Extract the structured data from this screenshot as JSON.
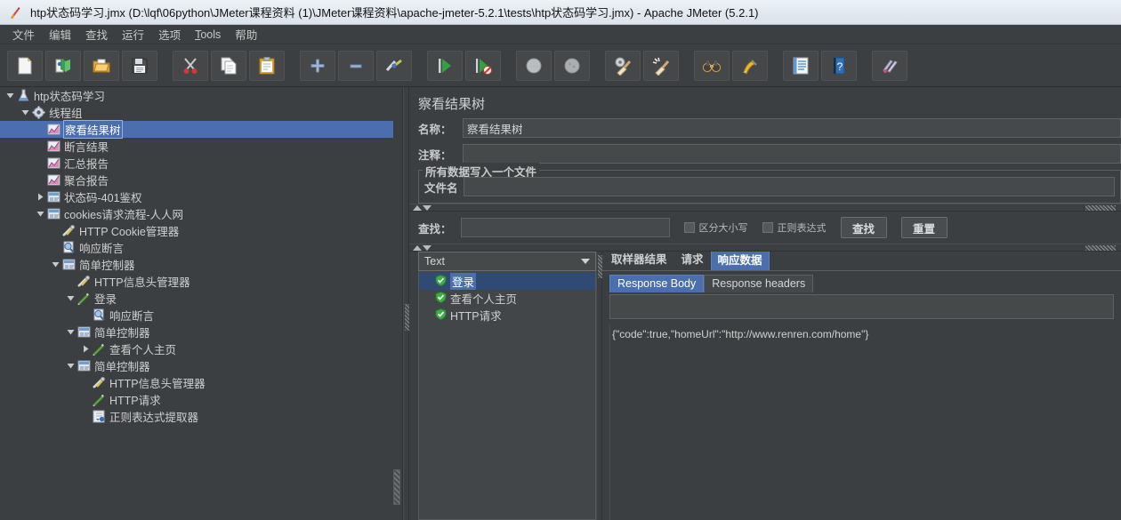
{
  "window": {
    "title": "htp状态码学习.jmx (D:\\lqf\\06python\\JMeter课程资料 (1)\\JMeter课程资料\\apache-jmeter-5.2.1\\tests\\htp状态码学习.jmx) - Apache JMeter (5.2.1)",
    "app_icon": "jmeter-feather-icon"
  },
  "menubar": {
    "items": [
      {
        "label": "文件"
      },
      {
        "label": "编辑"
      },
      {
        "label": "查找"
      },
      {
        "label": "运行"
      },
      {
        "label": "选项"
      },
      {
        "label": "Tools",
        "mnemonic": "T"
      },
      {
        "label": "帮助"
      }
    ]
  },
  "toolbar": {
    "buttons": [
      {
        "name": "new-test-plan",
        "icon": "new-document-icon"
      },
      {
        "name": "templates",
        "icon": "templates-icon"
      },
      {
        "name": "open",
        "icon": "open-folder-icon"
      },
      {
        "name": "save",
        "icon": "save-floppy-icon"
      },
      {
        "name": "cut",
        "icon": "scissors-icon"
      },
      {
        "name": "copy",
        "icon": "copy-pages-icon"
      },
      {
        "name": "paste",
        "icon": "clipboard-icon"
      },
      {
        "name": "expand-all",
        "icon": "plus-icon"
      },
      {
        "name": "collapse-all",
        "icon": "minus-icon"
      },
      {
        "name": "toggle",
        "icon": "toggle-pencil-icon"
      },
      {
        "name": "start",
        "icon": "green-play-icon"
      },
      {
        "name": "start-no-pauses",
        "icon": "green-play-nopause-icon"
      },
      {
        "name": "stop",
        "icon": "stop-circle-icon"
      },
      {
        "name": "shutdown",
        "icon": "shutdown-circle-icon"
      },
      {
        "name": "clear",
        "icon": "clear-broom-gear-icon"
      },
      {
        "name": "clear-all",
        "icon": "clear-all-broom-icon"
      },
      {
        "name": "search",
        "icon": "binoculars-icon"
      },
      {
        "name": "reset-search",
        "icon": "reset-brush-icon"
      },
      {
        "name": "function-helper",
        "icon": "function-list-icon"
      },
      {
        "name": "help",
        "icon": "help-question-icon"
      },
      {
        "name": "undo-redo",
        "icon": "feather-cluster-icon"
      }
    ]
  },
  "tree": {
    "items": [
      {
        "label": "htp状态码学习",
        "depth": 0,
        "twisty": "down",
        "icon": "test-plan-icon",
        "selected": false
      },
      {
        "label": "线程组",
        "depth": 1,
        "twisty": "down",
        "icon": "thread-group-gear-icon",
        "selected": false
      },
      {
        "label": "察看结果树",
        "depth": 2,
        "twisty": "none",
        "icon": "listener-chart-icon",
        "selected": true
      },
      {
        "label": "断言结果",
        "depth": 2,
        "twisty": "none",
        "icon": "listener-chart-icon",
        "selected": false
      },
      {
        "label": "汇总报告",
        "depth": 2,
        "twisty": "none",
        "icon": "listener-chart-icon",
        "selected": false
      },
      {
        "label": "聚合报告",
        "depth": 2,
        "twisty": "none",
        "icon": "listener-chart-icon",
        "selected": false
      },
      {
        "label": "状态码-401鉴权",
        "depth": 2,
        "twisty": "right",
        "icon": "controller-icon",
        "selected": false
      },
      {
        "label": "cookies请求流程-人人网",
        "depth": 2,
        "twisty": "down",
        "icon": "controller-icon",
        "selected": false
      },
      {
        "label": "HTTP Cookie管理器",
        "depth": 3,
        "twisty": "none",
        "icon": "config-wrench-icon",
        "selected": false
      },
      {
        "label": "响应断言",
        "depth": 3,
        "twisty": "none",
        "icon": "assertion-magnifier-icon",
        "selected": false
      },
      {
        "label": "简单控制器",
        "depth": 3,
        "twisty": "down",
        "icon": "controller-icon",
        "selected": false
      },
      {
        "label": "HTTP信息头管理器",
        "depth": 4,
        "twisty": "none",
        "icon": "config-wrench-icon",
        "selected": false
      },
      {
        "label": "登录",
        "depth": 4,
        "twisty": "down",
        "icon": "sampler-pencil-icon",
        "selected": false
      },
      {
        "label": "响应断言",
        "depth": 5,
        "twisty": "none",
        "icon": "assertion-magnifier-icon",
        "selected": false
      },
      {
        "label": "简单控制器",
        "depth": 4,
        "twisty": "down",
        "icon": "controller-icon",
        "selected": false
      },
      {
        "label": "查看个人主页",
        "depth": 5,
        "twisty": "right",
        "icon": "sampler-pencil-icon",
        "selected": false
      },
      {
        "label": "简单控制器",
        "depth": 4,
        "twisty": "down",
        "icon": "controller-icon",
        "selected": false
      },
      {
        "label": "HTTP信息头管理器",
        "depth": 5,
        "twisty": "none",
        "icon": "config-wrench-icon",
        "selected": false
      },
      {
        "label": "HTTP请求",
        "depth": 5,
        "twisty": "none",
        "icon": "sampler-pencil-icon",
        "selected": false
      },
      {
        "label": "正则表达式提取器",
        "depth": 5,
        "twisty": "none",
        "icon": "postprocessor-icon",
        "selected": false
      }
    ]
  },
  "listener": {
    "panel_title": "察看结果树",
    "name_label": "名称：",
    "name_value": "察看结果树",
    "comment_label": "注释：",
    "comment_value": "",
    "filegroup_legend": "所有数据写入一个文件",
    "filename_label": "文件名",
    "filename_value": ""
  },
  "search": {
    "label": "查找：",
    "value": "",
    "case_sensitive_label": "区分大小写",
    "case_sensitive_checked": false,
    "regex_label": "正则表达式",
    "regex_checked": false,
    "search_button": "查找",
    "reset_button": "重置"
  },
  "render": {
    "combo_selected": "Text",
    "results": [
      {
        "label": "登录",
        "status": "pass",
        "selected": true
      },
      {
        "label": "查看个人主页",
        "status": "pass",
        "selected": false
      },
      {
        "label": "HTTP请求",
        "status": "pass",
        "selected": false
      }
    ]
  },
  "result_tabs": {
    "tabs": [
      {
        "label": "取样器结果",
        "active": false
      },
      {
        "label": "请求",
        "active": false
      },
      {
        "label": "响应数据",
        "active": true
      }
    ],
    "subtabs": [
      {
        "label": "Response Body",
        "active": true
      },
      {
        "label": "Response headers",
        "active": false
      }
    ],
    "response_body": "{\"code\":true,\"homeUrl\":\"http://www.renren.com/home\"}"
  },
  "colors": {
    "window_bg": "#3c3f41",
    "selection_blue": "#4b6eaf",
    "field_bg": "#45494a",
    "text": "#cfcfcf",
    "border": "#5d6164",
    "titlebar_bg": "#e6ecf2"
  }
}
